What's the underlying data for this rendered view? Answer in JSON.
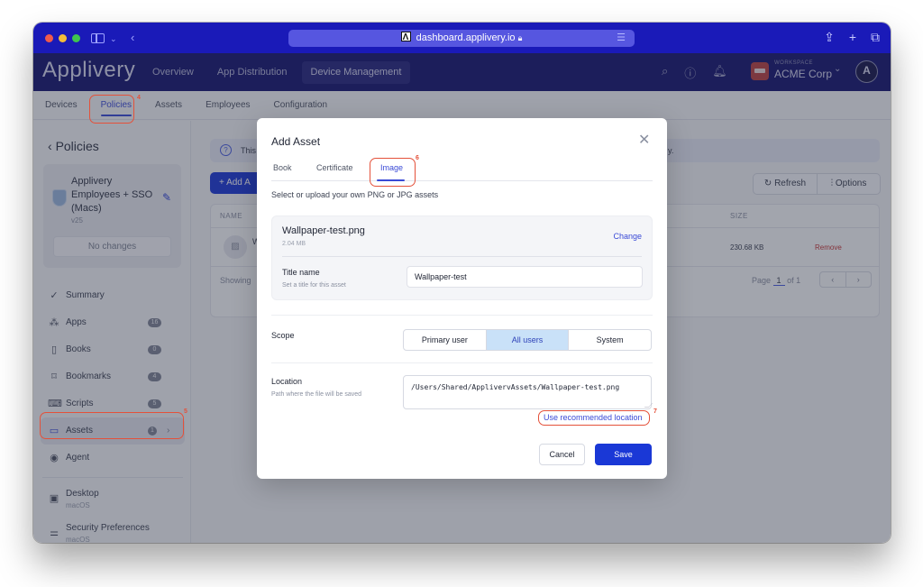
{
  "browser": {
    "url": "dashboard.applivery.io",
    "icons": [
      "sidebar-toggle-icon",
      "chevron-down-icon",
      "back-icon",
      "lock-icon",
      "reader-icon",
      "share-icon",
      "new-tab-icon",
      "tabs-overview-icon"
    ]
  },
  "app": {
    "brand": "Applivery",
    "nav": [
      {
        "label": "Overview",
        "active": false
      },
      {
        "label": "App Distribution",
        "active": false
      },
      {
        "label": "Device Management",
        "active": true
      }
    ],
    "workspace_label": "WORKSPACE",
    "workspace_name": "ACME Corp",
    "avatar_letter": "A"
  },
  "subnav": {
    "tabs": [
      {
        "label": "Devices",
        "active": false
      },
      {
        "label": "Policies",
        "active": true
      },
      {
        "label": "Assets",
        "active": false
      },
      {
        "label": "Employees",
        "active": false
      },
      {
        "label": "Configuration",
        "active": false
      }
    ]
  },
  "left_panel": {
    "back_label": "Policies",
    "policy": {
      "name": "Applivery Employees + SSO (Macs)",
      "version": "v25",
      "status_button": "No changes"
    },
    "menu": [
      {
        "label": "Summary",
        "icon": "check-circle-icon",
        "badge": null
      },
      {
        "label": "Apps",
        "icon": "apps-icon",
        "badge": "16"
      },
      {
        "label": "Books",
        "icon": "book-icon",
        "badge": "0"
      },
      {
        "label": "Bookmarks",
        "icon": "bookmark-icon",
        "badge": "4"
      },
      {
        "label": "Scripts",
        "icon": "terminal-icon",
        "badge": "5"
      },
      {
        "label": "Assets",
        "icon": "archive-icon",
        "badge": "1",
        "active": true
      },
      {
        "label": "Agent",
        "icon": "broadcast-icon",
        "badge": null
      }
    ],
    "config_items": [
      {
        "label": "Desktop",
        "sub": "macOS",
        "icon": "image-icon"
      },
      {
        "label": "Security Preferences",
        "sub": "macOS",
        "icon": "toggles-icon"
      }
    ]
  },
  "content": {
    "info_text": "This",
    "info_text_tail": "y.",
    "add_button": "+ Add A",
    "refresh_button": "Refresh",
    "options_button": "Options",
    "table": {
      "columns": [
        "NAME",
        "SIZE"
      ],
      "rows": [
        {
          "name": "W",
          "size": "230.68 KB",
          "action": "Remove"
        }
      ],
      "footer_text": "Showing",
      "page_label": "Page",
      "page_current": "1",
      "page_total": "of 1"
    }
  },
  "modal": {
    "title": "Add Asset",
    "tabs": [
      {
        "label": "Book",
        "active": false
      },
      {
        "label": "Certificate",
        "active": false
      },
      {
        "label": "Image",
        "active": true
      }
    ],
    "description": "Select or upload your own PNG or JPG assets",
    "file": {
      "name": "Wallpaper-test.png",
      "size": "2.04 MB",
      "change_label": "Change"
    },
    "title_field": {
      "label": "Title name",
      "help": "Set a title for this asset",
      "value": "Wallpaper-test"
    },
    "scope": {
      "label": "Scope",
      "options": [
        "Primary user",
        "All users",
        "System"
      ],
      "selected": "All users"
    },
    "location": {
      "label": "Location",
      "help": "Path where the file will be saved",
      "value": "/Users/Shared/ApplivervAssets/Wallpaper-test.png",
      "recommend_link": "Use recommended location"
    },
    "cancel_label": "Cancel",
    "save_label": "Save"
  },
  "annotations": [
    {
      "number": "4",
      "target": "Policies tab"
    },
    {
      "number": "5",
      "target": "Assets menu item"
    },
    {
      "number": "6",
      "target": "Image tab"
    },
    {
      "number": "7",
      "target": "Use recommended location link"
    }
  ],
  "colors": {
    "titlebar": "#1a1ab8",
    "appnav": "#14146e",
    "primary": "#1a38d6",
    "link": "#3a4ad6",
    "danger": "#c63838",
    "annotation": "#e4513a",
    "scope_selected": "#c9e1f8"
  }
}
